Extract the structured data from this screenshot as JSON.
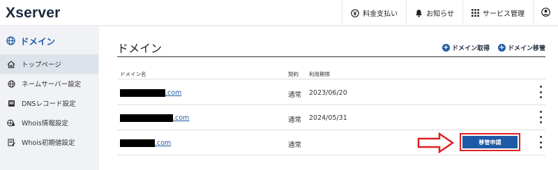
{
  "app": {
    "logo": "Xserver"
  },
  "topnav": {
    "items": [
      {
        "label": "料金支払い",
        "icon": "yen-icon"
      },
      {
        "label": "お知らせ",
        "icon": "bell-icon"
      },
      {
        "label": "サービス管理",
        "icon": "grid-icon"
      }
    ],
    "account_icon": "user-icon"
  },
  "sidebar": {
    "header": "ドメイン",
    "items": [
      {
        "label": "トップページ",
        "icon": "home-icon"
      },
      {
        "label": "ネームサーバー設定",
        "icon": "globe-icon"
      },
      {
        "label": "DNSレコード設定",
        "icon": "dns-icon"
      },
      {
        "label": "Whois情報設定",
        "icon": "whois-icon"
      },
      {
        "label": "Whois初期値設定",
        "icon": "edit-icon"
      }
    ]
  },
  "main": {
    "title": "ドメイン",
    "actions": [
      {
        "label": "ドメイン取得"
      },
      {
        "label": "ドメイン移管"
      }
    ],
    "columns": {
      "domain": "ドメイン名",
      "contract": "契約",
      "expiry": "利用期限"
    },
    "rows": [
      {
        "domain_suffix": ".com",
        "contract": "通常",
        "expiry": "2023/06/20"
      },
      {
        "domain_suffix": ".com",
        "contract": "通常",
        "expiry": "2024/05/31"
      },
      {
        "domain_suffix": ".com",
        "contract": "通常",
        "expiry": "",
        "transfer_button": "移管申請"
      }
    ]
  },
  "colors": {
    "accent": "#1f5aa6",
    "highlight": "#e02020",
    "logo": "#1b2a3c"
  }
}
